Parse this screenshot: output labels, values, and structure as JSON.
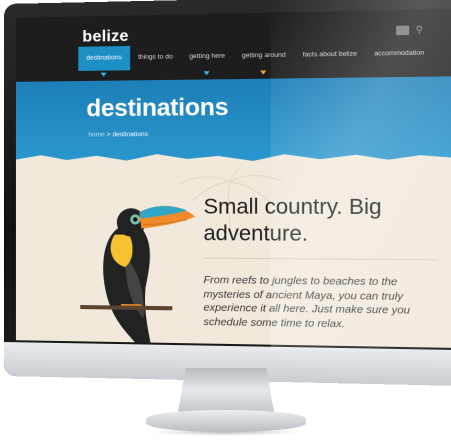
{
  "site": {
    "logo": "belize"
  },
  "nav": {
    "items": [
      {
        "label": "destinations",
        "active": true
      },
      {
        "label": "things to do"
      },
      {
        "label": "getting here"
      },
      {
        "label": "getting around"
      },
      {
        "label": "facts about belize"
      },
      {
        "label": "accommodation"
      }
    ]
  },
  "banner": {
    "title": "destinations",
    "breadcrumb_home": "home",
    "breadcrumb_sep": " > ",
    "breadcrumb_current": "destinations"
  },
  "content": {
    "headline": "Small country. Big adventure.",
    "intro": "From reefs to jungles to beaches to the mysteries of ancient Maya, you can truly experience it all here. Just make sure you schedule some time to relax."
  },
  "colors": {
    "accent": "#1d8fc5",
    "banner": "#2a97cd",
    "nav_bg": "#1d1d1d",
    "page_bg": "#f1e9dc"
  },
  "icons": [
    "search-icon",
    "toucan-illustration",
    "palm-icon"
  ]
}
